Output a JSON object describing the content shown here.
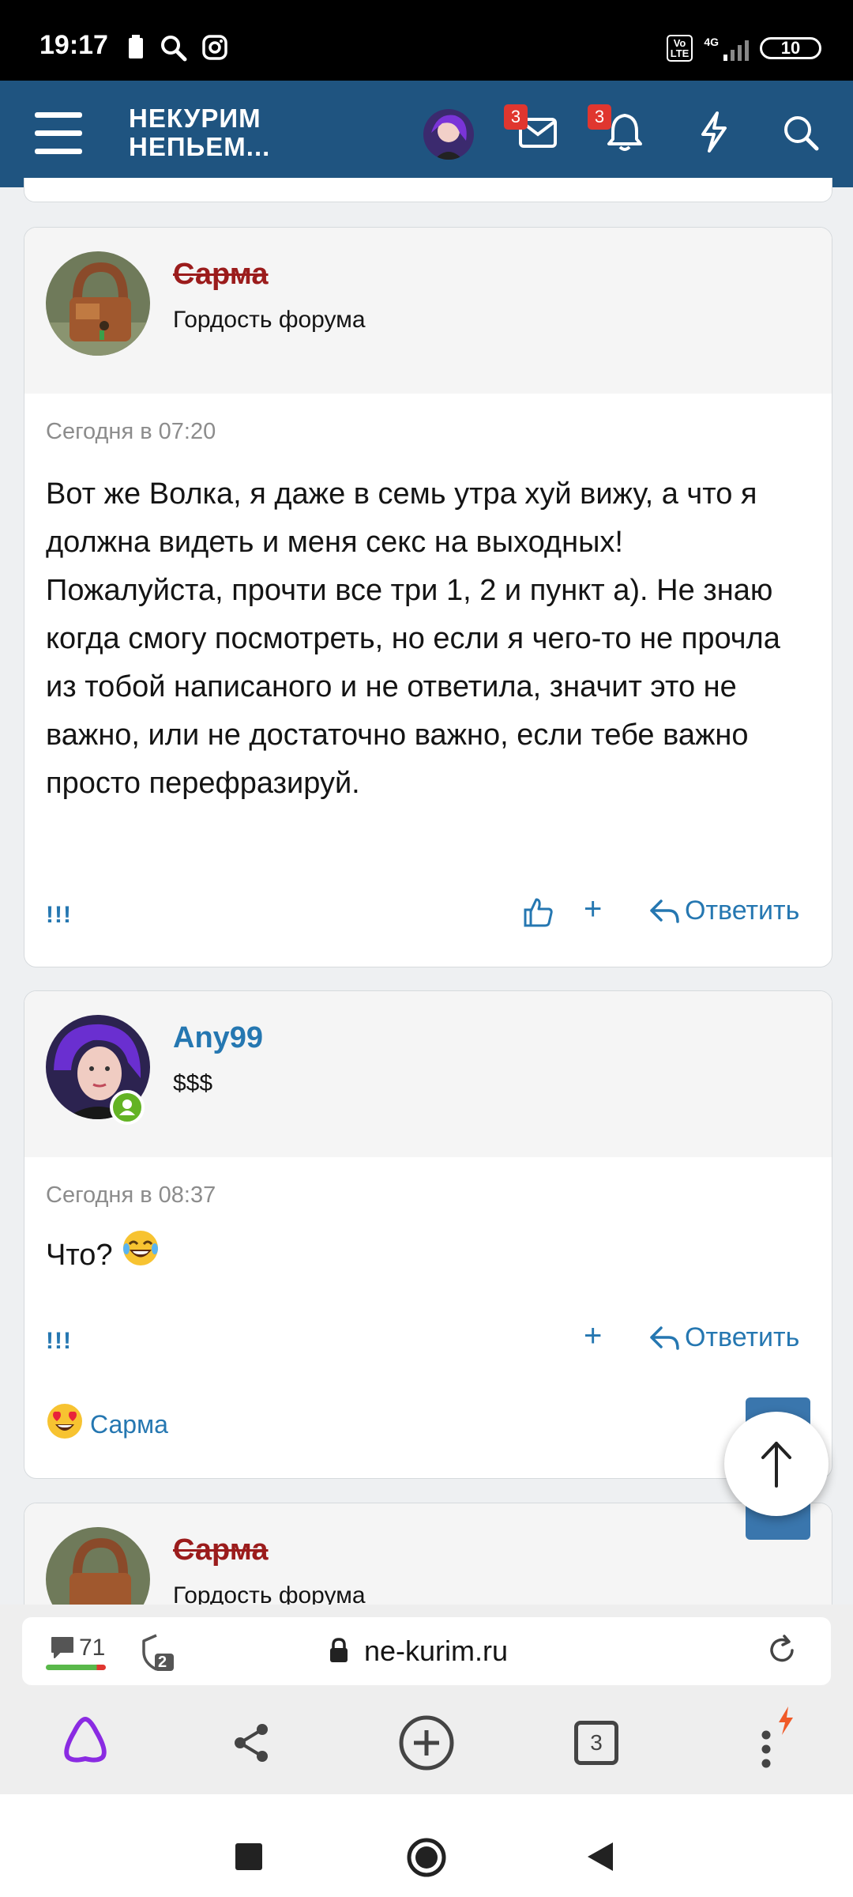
{
  "status_bar": {
    "time": "19:17",
    "network": "4G",
    "volte": "Vo\nLTE",
    "battery": "10",
    "icons": [
      "battery-saver-icon",
      "search-icon",
      "instagram-icon"
    ]
  },
  "header": {
    "logo_line1": "НЕКУРИМ",
    "logo_line2": "НЕПЬЕМ...",
    "messages_badge": "3",
    "alerts_badge": "3",
    "icons": [
      "menu-icon",
      "user-avatar",
      "mail-icon",
      "bell-icon",
      "lightning-icon",
      "search-icon"
    ]
  },
  "posts": [
    {
      "username": "Сарма",
      "user_title": "Гордость форума",
      "date": "Сегодня в 07:20",
      "body": "Вот же Волка, я даже в семь утра хуй вижу, а что я должна видеть и меня секс на выходных! Пожалуйста, прочти все три 1, 2 и пункт а). Не знаю когда смогу посмотреть, но если я чего-то не прочла из тобой написаного и не ответила, значит это не важно, или не достаточно важно, если тебе важно просто перефразируй.",
      "excl": "!!!",
      "plus": "+",
      "reply": "Ответить"
    },
    {
      "username": "Any99",
      "user_title": "$$$",
      "date": "Сегодня в 08:37",
      "body": "Что?",
      "excl": "!!!",
      "plus": "+",
      "reply": "Ответить",
      "reaction_user": "Сарма"
    },
    {
      "username": "Сарма",
      "user_title": "Гордость форума"
    }
  ],
  "browser": {
    "comments_count": "71",
    "tabs_badge": "2",
    "url": "ne-kurim.ru",
    "tab_count": "3"
  },
  "colors": {
    "header_bg": "#1f5480",
    "link": "#2577b1",
    "banned_name": "#9b1c1c",
    "badge": "#e0362f",
    "online": "#63b324"
  }
}
